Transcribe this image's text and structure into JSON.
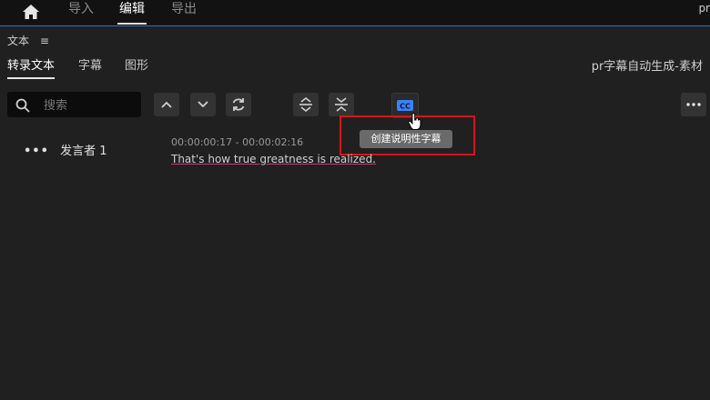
{
  "header": {
    "tabs": [
      {
        "label": "导入",
        "active": false
      },
      {
        "label": "编辑",
        "active": true
      },
      {
        "label": "导出",
        "active": false
      }
    ],
    "right_text": "pr",
    "accent_color": "#2f6fd6"
  },
  "panel": {
    "title": "文本",
    "menu_icon": "≡",
    "tabs": [
      {
        "label": "转录文本",
        "active": true
      },
      {
        "label": "字幕",
        "active": false
      },
      {
        "label": "图形",
        "active": false
      }
    ],
    "sequence_name": "pr字幕自动生成-素材"
  },
  "toolbar": {
    "search_placeholder": "搜索",
    "icons": [
      "chevron-up-icon",
      "chevron-down-icon",
      "refresh-icon",
      "expand-icon",
      "collapse-icon",
      "cc-icon",
      "more-icon"
    ],
    "cc_label": "CC",
    "tooltip": "创建说明性字幕",
    "highlight_color": "#d9121b"
  },
  "transcript": {
    "speaker": "发言者 1",
    "timecode": "00:00:00:17 - 00:00:02:16",
    "text": "That's how true greatness is realized."
  }
}
